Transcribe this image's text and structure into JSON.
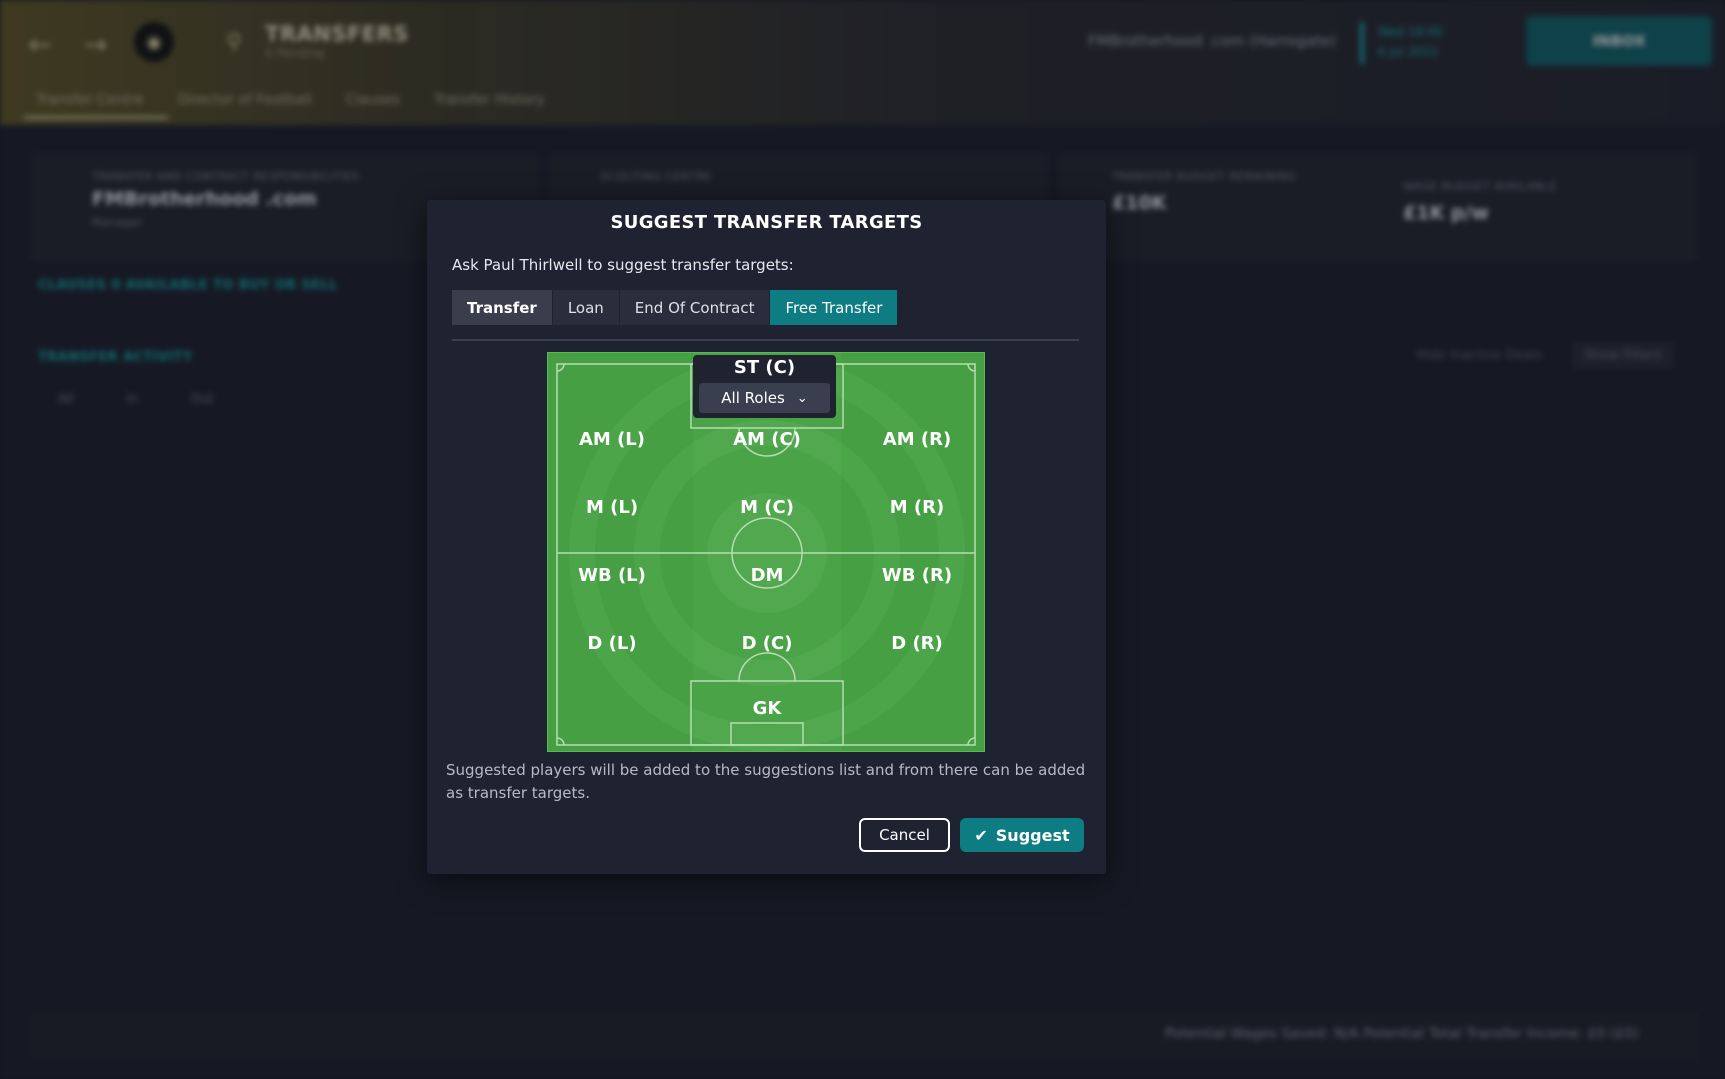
{
  "background": {
    "page_title": "TRANSFERS",
    "page_subtitle": "0 Pending",
    "tabs": [
      "Transfer Centre",
      "Director of Football",
      "Clauses",
      "Transfer History"
    ],
    "manager": "FMBrotherhood .com (Harrogate)",
    "date_line1": "Wed 18:00",
    "date_line2": "6 Jul 2022",
    "inbox_label": "INBOX",
    "responsibilities_label": "TRANSFER AND CONTRACT RESPONSIBILITIES",
    "responsibilities_value": "FMBrotherhood .com",
    "responsibilities_sub": "Manager",
    "scouting_label": "SCOUTING CENTRE",
    "budget_label": "TRANSFER BUDGET REMAINING",
    "budget_value": "£10K",
    "wage_label": "WAGE BUDGET AVAILABLE",
    "wage_value": "£1K p/w",
    "clauses_text": "CLAUSES  0 AVAILABLE TO BUY OR SELL",
    "activity_label": "TRANSFER ACTIVITY",
    "activity_tabs": [
      "All",
      "In",
      "Out"
    ],
    "hide_inactive": "Hide Inactive Deals",
    "show_filters": "Show Filters",
    "footer_text": "Potential Wages Saved: N/A   Potential Total Transfer Income: £0 (£0)"
  },
  "modal": {
    "title": "SUGGEST TRANSFER TARGETS",
    "prompt": "Ask Paul Thirlwell to suggest transfer targets:",
    "tabs": [
      {
        "label": "Transfer",
        "state": "selected"
      },
      {
        "label": "Loan",
        "state": "normal"
      },
      {
        "label": "End Of Contract",
        "state": "normal"
      },
      {
        "label": "Free Transfer",
        "state": "active"
      }
    ],
    "pitch": {
      "st_label": "ST (C)",
      "role_select": "All Roles",
      "positions": {
        "aml": "AM (L)",
        "amc": "AM (C)",
        "amr": "AM (R)",
        "ml": "M (L)",
        "mc": "M (C)",
        "mr": "M (R)",
        "wbl": "WB (L)",
        "dm": "DM",
        "wbr": "WB (R)",
        "dl": "D (L)",
        "dc": "D (C)",
        "dr": "D (R)",
        "gk": "GK"
      }
    },
    "note": "Suggested players will be added to the suggestions list and from there can be added as transfer targets.",
    "cancel_label": "Cancel",
    "suggest_label": "Suggest"
  },
  "colors": {
    "accent": "#0d7d83",
    "pitch_green": "#46a043",
    "modal_bg": "#1e2231"
  }
}
